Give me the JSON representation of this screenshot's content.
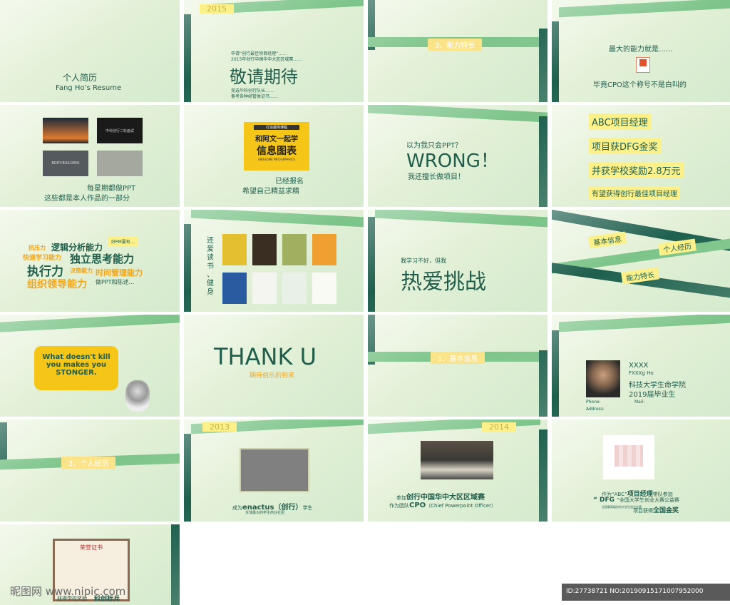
{
  "s1": {
    "title": "个人简历",
    "subtitle": "Fang Ho’s Resume"
  },
  "s2": {
    "year": "2015",
    "line1": "申请“创行最佳项目经理”……",
    "line2": "2015年创行中国华中大区区域赛……",
    "headline": "敬请期待",
    "line3": "竞选华科创行队长……",
    "line4": "备考各种经管类证书……"
  },
  "s3": {
    "section": "3、能力特长"
  },
  "s4": {
    "top": "最大的能力就是……",
    "bottom": "毕竟CPO这个称号不是白叫的"
  },
  "s5": {
    "t1": "中科创行二轮面试",
    "t2": "BODY-BUILDING",
    "t3": "每星期都做PPT",
    "t4": "这些都是本人作品的一部分"
  },
  "s6": {
    "book_top": "打造最简课程",
    "book_title1": "和阿文一起学",
    "book_title2": "信息图表",
    "book_sub": "AWESOME INFOGRAPHICS",
    "line1": "已经报名",
    "line2": "希望自己精益求精"
  },
  "s7": {
    "q": "以为我只会PPT？",
    "big": "WRONG！",
    "a": "我还擅长做项目！"
  },
  "s8": {
    "l1": "ABC项目经理",
    "l2": "项目获DFG金奖",
    "l3": "并获学校奖励2.8万元",
    "l4": "有望获得创行最佳项目经理"
  },
  "s9": {
    "w1": "抗压力",
    "w2": "逻辑分析能力",
    "w3": "好PM要有…",
    "w4": "快速学习能力",
    "w5": "独立思考能力",
    "w6": "执行力",
    "w7": "决策能力",
    "w8": "时间管理能力",
    "w9": "组织领导能力",
    "w10": "做PPT和陈述…"
  },
  "s10": {
    "v": [
      "还",
      "爱",
      "读",
      "书",
      "、",
      "健",
      "身"
    ]
  },
  "s11": {
    "small": "我学习不好，但我",
    "big": "热爱挑战"
  },
  "s12": {
    "tag1": "基本信息",
    "tag2": "个人经历",
    "tag3": "能力特长"
  },
  "s13": {
    "quote1": "What doesn't kill",
    "quote2": "you makes you",
    "quote3": "STONGER."
  },
  "s14": {
    "big": "THANK U",
    "sub": "期待伯乐的到来"
  },
  "s15": {
    "section": "1、基本信息"
  },
  "s16": {
    "name": "XXXX",
    "en": "FXXXg Ho",
    "school": "科技大学生命学院",
    "grad": "2019届毕业生",
    "phone": "Phone:",
    "mail": "Mail:",
    "address": "Address:"
  },
  "s17": {
    "section": "2、个人经历"
  },
  "s18": {
    "year": "2013",
    "l1a": "成为",
    "l1b": "enactus（创行）",
    "l1c": "学生",
    "l2": "全球最大的学生商业社团"
  },
  "s19": {
    "year": "2014",
    "l1a": "参加",
    "l1b": "创行中国华中大区区域赛",
    "l2a": "作为团队",
    "l2b": "CPO",
    "l2c": "（Chief Powerpoint Officer）"
  },
  "s20": {
    "l1a": "作为“ABC”",
    "l1b": "项目经理",
    "l1c": "带队参加",
    "l2a": "“ DFG ",
    "l2b": "”全国大学生创业大赛公益赛",
    "l3": "全国最高级别的大学生创业比赛",
    "l4a": "项目获得",
    "l4b": "全国金奖"
  },
  "s21": {
    "cert": "荣誉证书",
    "l1": "获得学校奖励",
    "l2": "科创标兵"
  },
  "footer": {
    "watermark": "昵图网 www.nipic.com",
    "id": "ID:27738721 NO:20190915171007952000"
  },
  "colors": {
    "dark_green": "#1e5f4e",
    "light_green": "#7cc489",
    "yellow": "#fbf08a",
    "orange": "#f3a51b"
  }
}
